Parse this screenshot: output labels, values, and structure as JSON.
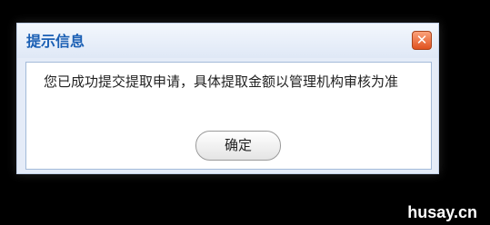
{
  "dialog": {
    "title": "提示信息",
    "close_icon": "close-icon",
    "close_symbol": "✕",
    "message": "您已成功提交提取申请，具体提取金额以管理机构审核为准",
    "ok_label": "确定"
  },
  "watermark": {
    "text": "husay.cn"
  },
  "colors": {
    "background": "#000000",
    "title": "#1a5fb4",
    "close_button": "#e0521f",
    "content_border": "#a3bad9"
  }
}
